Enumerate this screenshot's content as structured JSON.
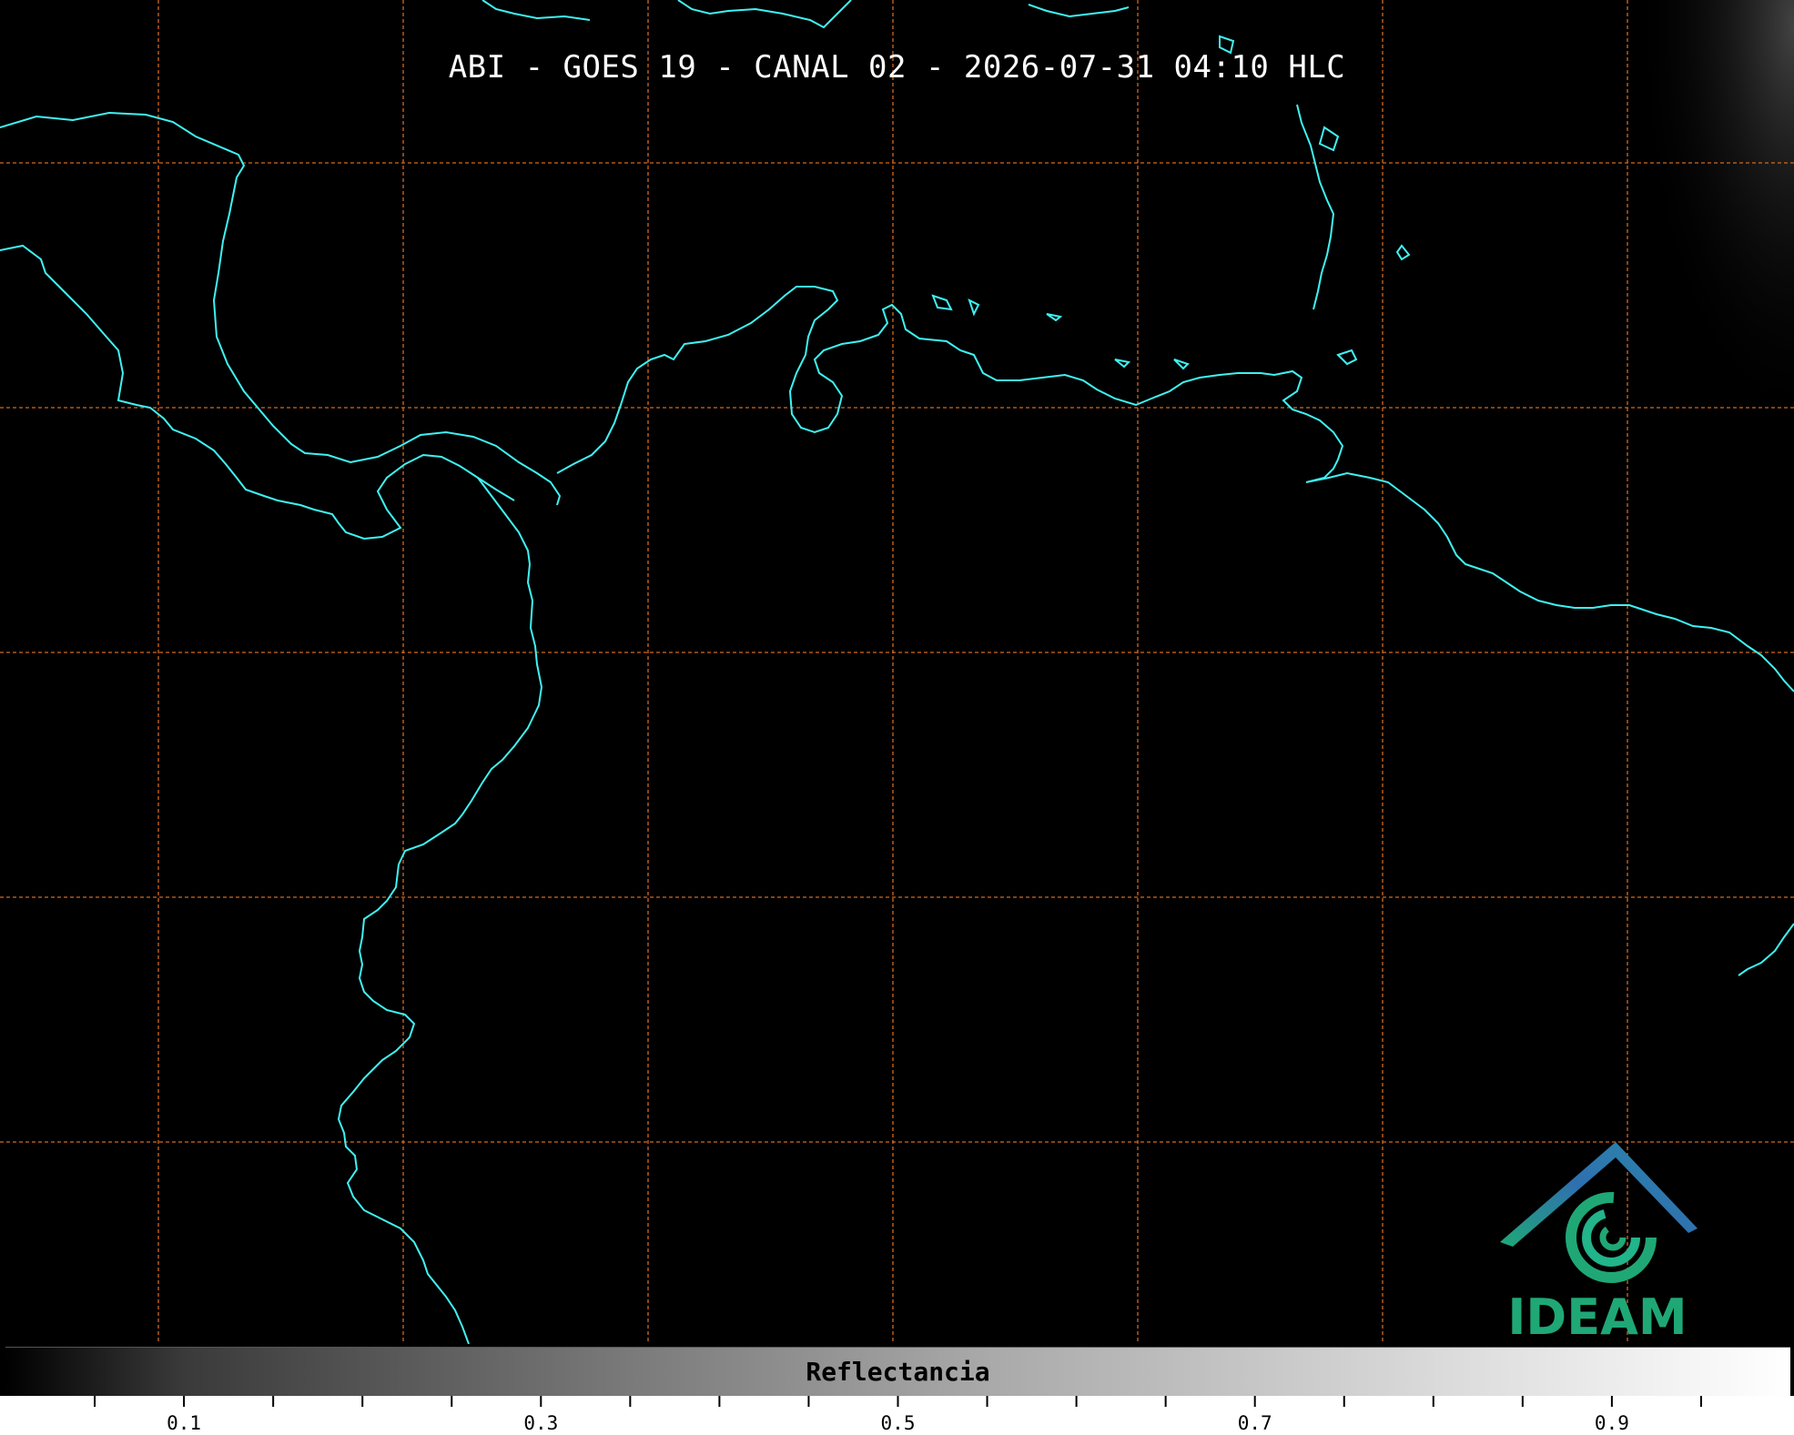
{
  "title": "ABI - GOES 19 - CANAL 02 - 2026-07-31 04:10 HLC",
  "map": {
    "background": "#000000",
    "coastline_color": "#3ff2f2",
    "grid_color": "#d2691e",
    "grid_style": "dashed"
  },
  "logo": {
    "text": "IDEAM",
    "colors": {
      "roof": "#2f6fb0",
      "swirl": "#1fa876",
      "text": "#1fa876"
    }
  },
  "colorbar": {
    "label": "Reflectancia",
    "range": [
      0.0,
      1.0
    ],
    "colormap": "grayscale",
    "tick_labels": [
      "0.1",
      "0.3",
      "0.5",
      "0.7",
      "0.9"
    ],
    "tick_values": [
      0.1,
      0.3,
      0.5,
      0.7,
      0.9
    ],
    "minor_step": 0.05
  }
}
